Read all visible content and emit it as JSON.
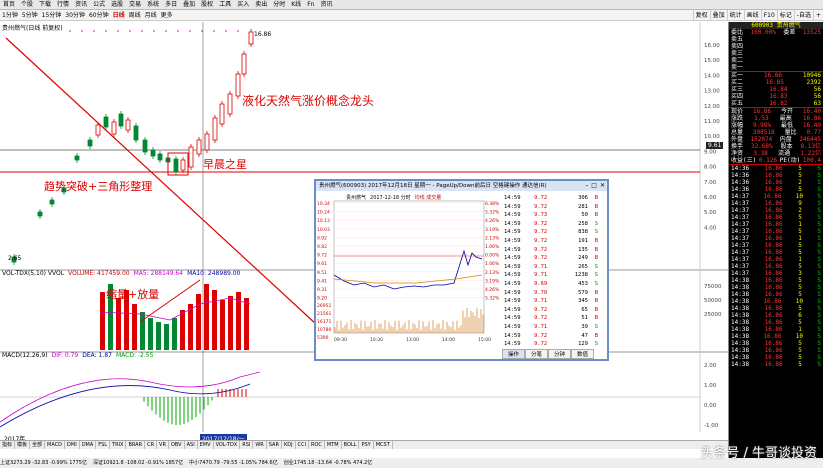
{
  "topbar": {
    "items": [
      "首页",
      "个股",
      "下载",
      "行情",
      "资讯",
      "公式",
      "选股",
      "交易",
      "系统",
      "多日",
      "叠加",
      "股权",
      "工具",
      "买入",
      "卖出",
      "分时",
      "K线",
      "Fn",
      "资讯"
    ],
    "menu_label": "主菜单"
  },
  "periodbar": {
    "items": [
      "1分钟",
      "5分钟",
      "15分钟",
      "30分钟",
      "60分钟",
      "日线",
      "周线",
      "月线",
      "更多"
    ],
    "active": "日线",
    "right": [
      "复权",
      "叠加",
      "统计",
      "画线",
      "F10",
      "标记",
      "-自选",
      "+"
    ]
  },
  "kline": {
    "title": "贵州燃气(日线 前复权)",
    "high_label": "16.86",
    "low_label": "2.65",
    "annotation_main": "液化天然气涨价概念龙头",
    "annotation_star": "早晨之星",
    "annotation_trend": "趋势突破+三角形整理",
    "price_axis": [
      "16.00",
      "15.00",
      "14.00",
      "13.00",
      "12.00",
      "11.00",
      "10.00",
      "9.00",
      "8.00",
      "7.00",
      "6.00",
      "5.00",
      "4.00"
    ],
    "price_tag": "9.61"
  },
  "vol": {
    "title": "VOL-TDX(5,10) VVOL",
    "vol_label": "VOLUME: 417459.00",
    "ma5_label": "MA5: 288149.64",
    "ma10_label": "MA10: 248989.00",
    "annotation": "缩量+放量",
    "axis": [
      "75000",
      "50000",
      "25000"
    ]
  },
  "macd": {
    "title": "MACD(12,26,9)",
    "dif_label": "DIF: 0.79",
    "dea_label": "DEA: 1.87",
    "macd_label": "MACD: -2.55",
    "axis": [
      "2.00",
      "1.00",
      "0.00",
      "-1.00"
    ]
  },
  "time_axis": {
    "left": "2017年",
    "highlight": "2017/12/18/一"
  },
  "bottomtabs": [
    "指标",
    "模板",
    "全部",
    "MACD",
    "DMI",
    "DMA",
    "FSL",
    "TRIX",
    "BRAR",
    "CR",
    "VR",
    "OBV",
    "ASI",
    "EMV",
    "VOL-TDX",
    "RSI",
    "WR",
    "SAR",
    "KDJ",
    "CCI",
    "ROC",
    "MTM",
    "BOLL",
    "PSY",
    "MCST"
  ],
  "statusbar": [
    "上证3273.29 -32.83 -0.99% 1775亿",
    "深证10921.8 -108.02 -0.91% 1857亿",
    "中小7470.79 -79.55 -1.05% 784.6亿",
    "创业1745.18 -13.64 -0.78% 474.2亿"
  ],
  "watermark": "头条号 / 牛哥谈投资",
  "quote": {
    "code": "600903",
    "name": "贵州燃气",
    "weibi_label": "委比",
    "weibi_val": "100.00%",
    "weicha_label": "委差",
    "weicha_val": "13525",
    "sells": [
      {
        "label": "卖五",
        "price": "",
        "vol": ""
      },
      {
        "label": "卖四",
        "price": "",
        "vol": ""
      },
      {
        "label": "卖三",
        "price": "",
        "vol": ""
      },
      {
        "label": "卖二",
        "price": "",
        "vol": ""
      },
      {
        "label": "卖一",
        "price": "",
        "vol": ""
      }
    ],
    "buys": [
      {
        "label": "买一",
        "price": "16.86",
        "vol": "10946"
      },
      {
        "label": "买二",
        "price": "16.85",
        "vol": "2392"
      },
      {
        "label": "买三",
        "price": "16.84",
        "vol": "56"
      },
      {
        "label": "买四",
        "price": "16.83",
        "vol": "56"
      },
      {
        "label": "买五",
        "price": "16.82",
        "vol": "63"
      }
    ],
    "stats": [
      [
        "现价",
        "16.86",
        "今开",
        "16.40"
      ],
      [
        "涨跌",
        "1.53",
        "最高",
        "16.86"
      ],
      [
        "涨幅",
        "9.98%",
        "最低",
        "16.40"
      ],
      [
        "总量",
        "398518",
        "量比",
        "0.77"
      ],
      [
        "外盘",
        "152074",
        "内盘",
        "246445"
      ],
      [
        "换手",
        "32.68%",
        "股本",
        "8.13亿"
      ],
      [
        "净资",
        "3.38",
        "流通",
        "1.22亿"
      ],
      [
        "收益(三)",
        "0.126",
        "PE(动)",
        "100.4"
      ]
    ]
  },
  "ticks": [
    [
      "14:36",
      "16.86",
      "5",
      "S"
    ],
    [
      "14:36",
      "16.86",
      "5",
      "S"
    ],
    [
      "14:36",
      "16.86",
      "2",
      "S"
    ],
    [
      "14:36",
      "16.86",
      "5",
      "S"
    ],
    [
      "14:37",
      "16.86",
      "10",
      "S"
    ],
    [
      "14:37",
      "16.86",
      "9",
      "S"
    ],
    [
      "14:37",
      "16.86",
      "2",
      "S"
    ],
    [
      "14:37",
      "16.86",
      "5",
      "S"
    ],
    [
      "14:37",
      "16.86",
      "1",
      "S"
    ],
    [
      "14:37",
      "16.86",
      "5",
      "S"
    ],
    [
      "14:37",
      "16.86",
      "1",
      "S"
    ],
    [
      "14:37",
      "16.86",
      "5",
      "S"
    ],
    [
      "14:37",
      "16.86",
      "5",
      "S"
    ],
    [
      "14:37",
      "16.86",
      "1",
      "S"
    ],
    [
      "14:37",
      "16.86",
      "5",
      "S"
    ],
    [
      "14:37",
      "16.86",
      "3",
      "S"
    ],
    [
      "14:38",
      "16.86",
      "5",
      "S"
    ],
    [
      "14:38",
      "16.86",
      "5",
      "S"
    ],
    [
      "14:38",
      "16.86",
      "5",
      "S"
    ],
    [
      "14:38",
      "16.86",
      "10",
      "S"
    ],
    [
      "14:38",
      "16.86",
      "5",
      "S"
    ],
    [
      "14:38",
      "16.86",
      "6",
      "S"
    ],
    [
      "14:38",
      "16.86",
      "5",
      "S"
    ],
    [
      "14:38",
      "16.86",
      "1",
      "S"
    ],
    [
      "14:38",
      "16.86",
      "10",
      "S"
    ],
    [
      "14:38",
      "16.86",
      "5",
      "S"
    ],
    [
      "14:38",
      "16.86",
      "5",
      "S"
    ],
    [
      "14:38",
      "16.86",
      "5",
      "S"
    ],
    [
      "14:38",
      "16.86",
      "5",
      "S"
    ]
  ],
  "popup": {
    "title": "贵州燃气(600903) 2017年12月18日 星期一 - PageUp/Down前后日 空格键操作 通达信(R)",
    "chart_header": "贵州燃气",
    "chart_date": "2017-12-18 分时",
    "chart_vol_label": "均线 成交量",
    "price_axis_left": [
      "10.34",
      "10.24",
      "10.13",
      "10.03",
      "9.92",
      "9.82",
      "9.72",
      "9.61",
      "9.51",
      "9.41",
      "9.31",
      "9.20"
    ],
    "price_axis_right": [
      "6.38%",
      "5.32%",
      "4.26%",
      "3.19%",
      "2.13%",
      "1.06%",
      "0.00%",
      "1.06%",
      "2.13%",
      "3.19%",
      "4.26%",
      "5.32%"
    ],
    "vol_axis": [
      "26951",
      "21561",
      "16171",
      "10780",
      "5390"
    ],
    "time_axis": [
      "09:30",
      "10:30",
      "13:00",
      "14:00",
      "15:00"
    ],
    "tabs": [
      "操作",
      "分笔",
      "分钟",
      "数值"
    ],
    "ticks": [
      [
        "14:59",
        "9.72",
        "306",
        "B"
      ],
      [
        "14:59",
        "9.72",
        "281",
        "B"
      ],
      [
        "14:59",
        "9.73",
        "50",
        "B"
      ],
      [
        "14:59",
        "9.72",
        "258",
        "S"
      ],
      [
        "14:59",
        "9.72",
        "838",
        "S"
      ],
      [
        "14:59",
        "9.72",
        "191",
        "B"
      ],
      [
        "14:59",
        "9.72",
        "135",
        "B"
      ],
      [
        "14:59",
        "9.72",
        "249",
        "B"
      ],
      [
        "14:59",
        "9.71",
        "265",
        "S"
      ],
      [
        "14:59",
        "9.71",
        "1238",
        "S"
      ],
      [
        "14:59",
        "9.69",
        "453",
        "S"
      ],
      [
        "14:59",
        "9.70",
        "579",
        "B"
      ],
      [
        "14:59",
        "9.71",
        "345",
        "B"
      ],
      [
        "14:59",
        "9.72",
        "65",
        "B"
      ],
      [
        "14:59",
        "9.72",
        "51",
        "B"
      ],
      [
        "14:59",
        "9.71",
        "39",
        "S"
      ],
      [
        "14:59",
        "9.72",
        "47",
        "B"
      ],
      [
        "14:59",
        "9.72",
        "129",
        "S"
      ]
    ]
  }
}
